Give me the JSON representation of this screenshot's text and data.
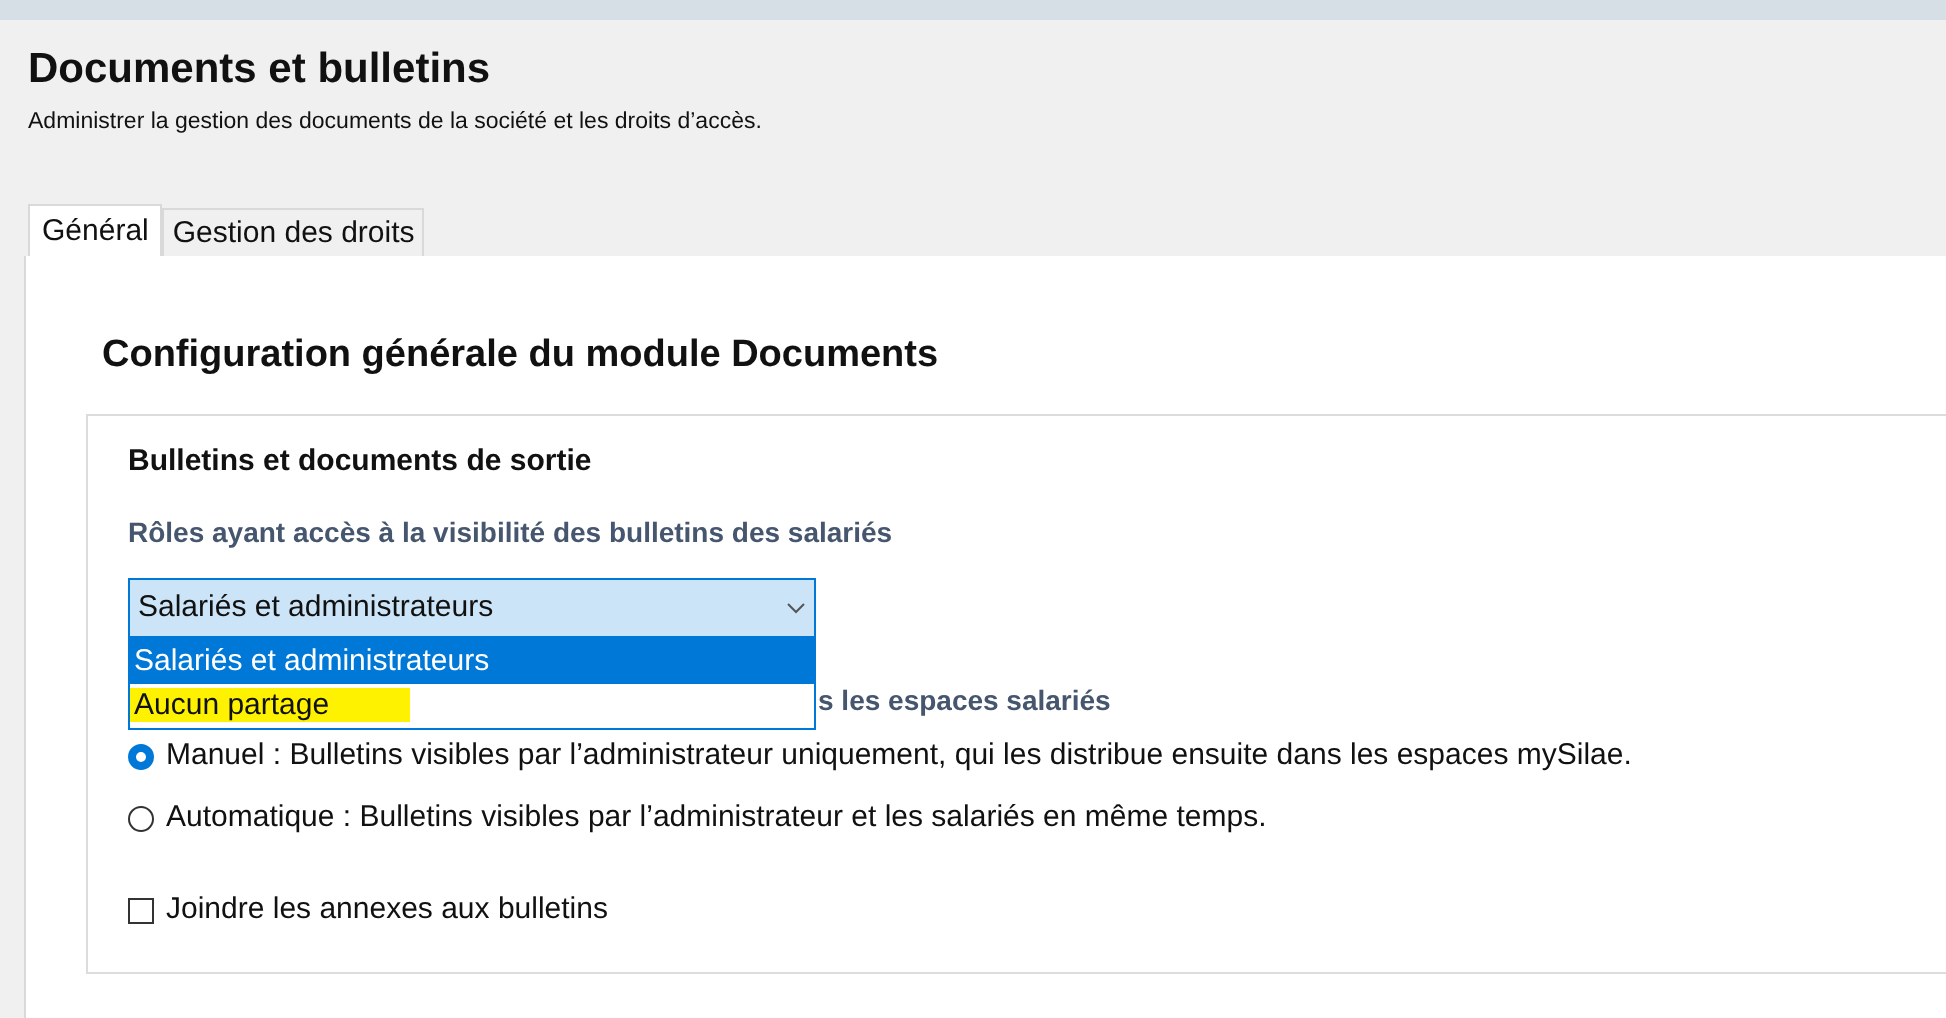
{
  "header": {
    "title": "Documents et bulletins",
    "subtitle": "Administrer la gestion des documents de la société et les droits d’accès."
  },
  "tabs": [
    {
      "label": "Général",
      "selected": true
    },
    {
      "label": "Gestion des droits",
      "selected": false
    }
  ],
  "panel": {
    "title": "Configuration générale du module Documents",
    "group": {
      "title": "Bulletins et documents de sortie",
      "roles_label": "Rôles ayant accès à la visibilité des bulletins des salariés",
      "select": {
        "value": "Salariés et administrateurs",
        "expanded": true,
        "options": [
          {
            "label": "Salariés et administrateurs",
            "selected": true,
            "highlighted": false
          },
          {
            "label": "Aucun partage",
            "selected": false,
            "highlighted": true
          }
        ]
      },
      "distribution_label": "s les espaces salariés",
      "radios": [
        {
          "label": "Manuel : Bulletins visibles par l’administrateur uniquement, qui les distribue ensuite dans les espaces mySilae.",
          "selected": true
        },
        {
          "label": "Automatique : Bulletins visibles par l’administrateur et les salariés en même temps.",
          "selected": false
        }
      ],
      "checkbox": {
        "label": "Joindre les annexes aux bulletins",
        "checked": false
      }
    }
  }
}
